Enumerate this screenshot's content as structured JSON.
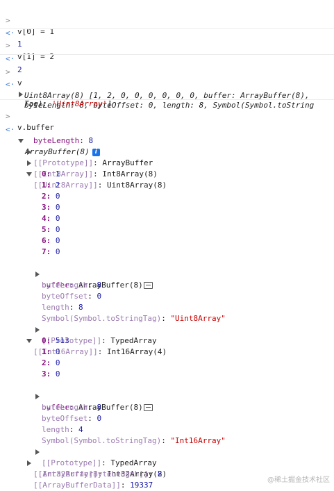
{
  "console": {
    "input_prompt_icon": "chevron-right-icon",
    "result_icon": "return-arrow-icon",
    "entries": {
      "cmd1": "v[0] = 1",
      "res1": "1",
      "cmd2": "v[1] = 2",
      "res2": "2",
      "cmd3": "v",
      "res3_line1": "Uint8Array(8) [1, 2, 0, 0, 0, 0, 0, 0, buffer: ArrayBuffer(8),",
      "res3_line2": "byteLength: 8, byteOffset: 0, length: 8, Symbol(Symbol.toString",
      "res3_line3a": "Tag): ",
      "res3_line3b": "'Uint8Array'",
      "res3_line3c": "]",
      "cmd4": "v.buffer"
    },
    "tree": {
      "root": "ArrayBuffer(8)",
      "root_info_badge": "i",
      "byteLength_key": "byteLength",
      "byteLength_val": "8",
      "proto_key": "[[Prototype]]",
      "proto_val": "ArrayBuffer",
      "int8_key": "[[Int8Array]]",
      "int8_val": "Int8Array(8)",
      "uint8_key": "[[Uint8Array]]",
      "uint8_val": "Uint8Array(8)",
      "uint8_items": [
        {
          "k": "0",
          "v": "1"
        },
        {
          "k": "1",
          "v": "2"
        },
        {
          "k": "2",
          "v": "0"
        },
        {
          "k": "3",
          "v": "0"
        },
        {
          "k": "4",
          "v": "0"
        },
        {
          "k": "5",
          "v": "0"
        },
        {
          "k": "6",
          "v": "0"
        },
        {
          "k": "7",
          "v": "0"
        }
      ],
      "u_buffer_key": "buffer",
      "u_buffer_val": "ArrayBuffer(8)",
      "u_bytelength_key": "byteLength",
      "u_bytelength_val": "8",
      "u_byteoffset_key": "byteOffset",
      "u_byteoffset_val": "0",
      "u_length_key": "length",
      "u_length_val": "8",
      "u_tag_key": "Symbol(Symbol.toStringTag)",
      "u_tag_val": "\"Uint8Array\"",
      "u_proto_key": "[[Prototype]]",
      "u_proto_val": "TypedArray",
      "int16_key": "[[Int16Array]]",
      "int16_val": "Int16Array(4)",
      "int16_items": [
        {
          "k": "0",
          "v": "513"
        },
        {
          "k": "1",
          "v": "0"
        },
        {
          "k": "2",
          "v": "0"
        },
        {
          "k": "3",
          "v": "0"
        }
      ],
      "i_buffer_key": "buffer",
      "i_buffer_val": "ArrayBuffer(8)",
      "i_bytelength_key": "byteLength",
      "i_bytelength_val": "8",
      "i_byteoffset_key": "byteOffset",
      "i_byteoffset_val": "0",
      "i_length_key": "length",
      "i_length_val": "4",
      "i_tag_key": "Symbol(Symbol.toStringTag)",
      "i_tag_val": "\"Int16Array\"",
      "i_proto_key": "[[Prototype]]",
      "i_proto_val": "TypedArray",
      "int32_key": "[[Int32Array]]",
      "int32_val": "Int32Array(2)",
      "abbl_key": "[[ArrayBufferByteLength]]",
      "abbl_val": "8",
      "abd_key": "[[ArrayBufferData]]",
      "abd_val": "19337"
    },
    "watermark": "@稀土掘金技术社区"
  }
}
